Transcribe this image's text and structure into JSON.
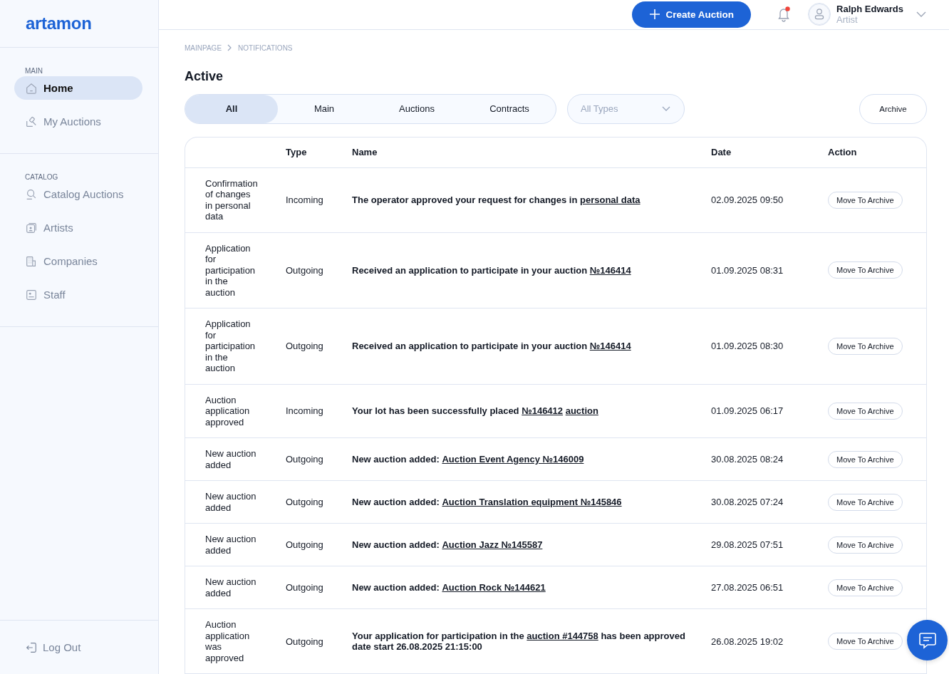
{
  "logo": "artamon",
  "sidebar": {
    "sections": [
      {
        "heading": "MAIN",
        "items": [
          {
            "label": "Home",
            "selected": true
          },
          {
            "label": "My Auctions",
            "selected": false
          }
        ]
      },
      {
        "heading": "CATALOG",
        "items": [
          {
            "label": "Catalog Auctions",
            "selected": false
          },
          {
            "label": "Artists",
            "selected": false
          },
          {
            "label": "Companies",
            "selected": false
          },
          {
            "label": "Staff",
            "selected": false
          }
        ]
      }
    ],
    "logout": "Log Out"
  },
  "header": {
    "create_button": "Create Auction",
    "notifications_unread": true,
    "user": {
      "name": "Ralph Edwards",
      "role": "Artist"
    }
  },
  "breadcrumb": [
    "MAINPAGE",
    "NOTIFICATIONS"
  ],
  "title": "Active",
  "tabs": [
    {
      "label": "All",
      "selected": true
    },
    {
      "label": "Main",
      "selected": false
    },
    {
      "label": "Auctions",
      "selected": false
    },
    {
      "label": "Contracts",
      "selected": false
    }
  ],
  "type_filter": {
    "placeholder": "All Types"
  },
  "archive_button": "Archive",
  "table": {
    "columns": [
      "Type",
      "Name",
      "Date",
      "Action"
    ],
    "rows": [
      {
        "subject": "Confirmation of changes in personal data",
        "type": "Incoming",
        "name": [
          {
            "kind": "text",
            "text": "The operator approved your request for changes in"
          },
          {
            "kind": "link",
            "text": "personal data"
          }
        ],
        "date": "02.09.2025 09:50",
        "action": "Move To Archive"
      },
      {
        "subject": "Application for participation in the auction",
        "type": "Outgoing",
        "name": [
          {
            "kind": "text",
            "text": "Received an application to participate in your auction"
          },
          {
            "kind": "link",
            "text": "№146414"
          }
        ],
        "date": "01.09.2025 08:31",
        "action": "Move To Archive"
      },
      {
        "subject": "Application for participation in the auction",
        "type": "Outgoing",
        "name": [
          {
            "kind": "text",
            "text": "Received an application to participate in your auction"
          },
          {
            "kind": "link",
            "text": "№146414"
          }
        ],
        "date": "01.09.2025 08:30",
        "action": "Move To Archive"
      },
      {
        "subject": "Auction application approved",
        "type": "Incoming",
        "name": [
          {
            "kind": "text",
            "text": "Your lot has been successfully placed"
          },
          {
            "kind": "link",
            "text": "№146412"
          },
          {
            "kind": "link",
            "text": "auction"
          }
        ],
        "date": "01.09.2025 06:17",
        "action": "Move To Archive"
      },
      {
        "subject": "New auction added",
        "type": "Outgoing",
        "name": [
          {
            "kind": "text",
            "text": "New auction added:"
          },
          {
            "kind": "link",
            "text": "Auction Event Agency №146009"
          }
        ],
        "date": "30.08.2025 08:24",
        "action": "Move To Archive"
      },
      {
        "subject": "New auction added",
        "type": "Outgoing",
        "name": [
          {
            "kind": "text",
            "text": "New auction added:"
          },
          {
            "kind": "link",
            "text": "Auction Translation equipment №145846"
          }
        ],
        "date": "30.08.2025 07:24",
        "action": "Move To Archive"
      },
      {
        "subject": "New auction added",
        "type": "Outgoing",
        "name": [
          {
            "kind": "text",
            "text": "New auction added:"
          },
          {
            "kind": "link",
            "text": "Auction Jazz №145587"
          }
        ],
        "date": "29.08.2025 07:51",
        "action": "Move To Archive"
      },
      {
        "subject": "New auction added",
        "type": "Outgoing",
        "name": [
          {
            "kind": "text",
            "text": "New auction added:"
          },
          {
            "kind": "link",
            "text": "Auction Rock №144621"
          }
        ],
        "date": "27.08.2025 06:51",
        "action": "Move To Archive"
      },
      {
        "subject": "Auction application was approved",
        "type": "Outgoing",
        "name": [
          {
            "kind": "text",
            "text": "Your application for participation in the"
          },
          {
            "kind": "link",
            "text": "auction #144758"
          },
          {
            "kind": "text",
            "text": "has been approved date start 26.08.2025 21:15:00"
          }
        ],
        "date": "26.08.2025 19:02",
        "action": "Move To Archive"
      }
    ]
  }
}
